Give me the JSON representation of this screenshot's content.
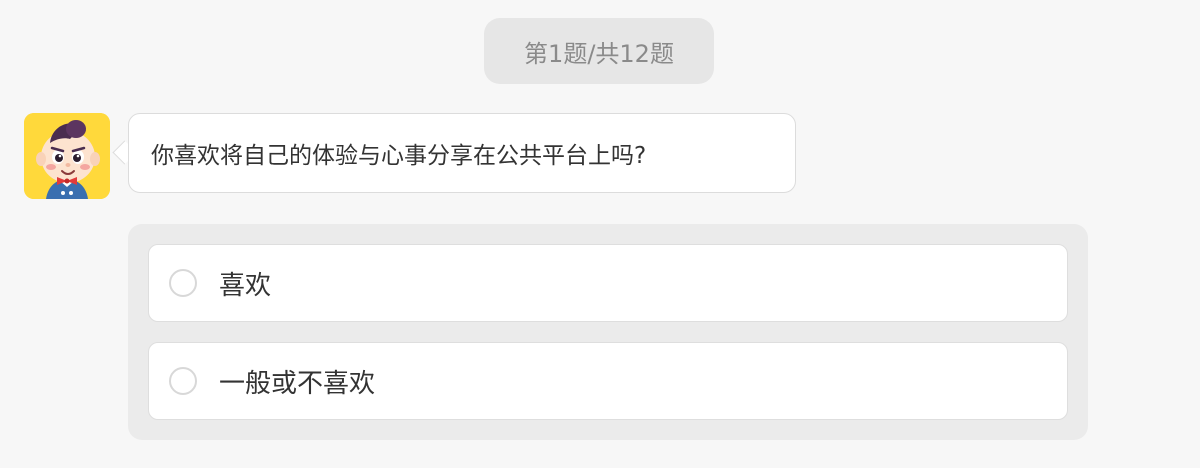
{
  "progress": {
    "label": "第1题/共12题",
    "current": 1,
    "total": 12
  },
  "question": {
    "avatar_icon": "cartoon-boy-avatar",
    "text": "你喜欢将自己的体验与心事分享在公共平台上吗?"
  },
  "options": [
    {
      "label": "喜欢",
      "selected": false
    },
    {
      "label": "一般或不喜欢",
      "selected": false
    }
  ],
  "colors": {
    "page_background": "#f7f7f7",
    "avatar_background": "#ffd93b",
    "panel_background": "#ebebeb",
    "progress_background": "#e6e6e6",
    "progress_text": "#8a8a8a"
  }
}
